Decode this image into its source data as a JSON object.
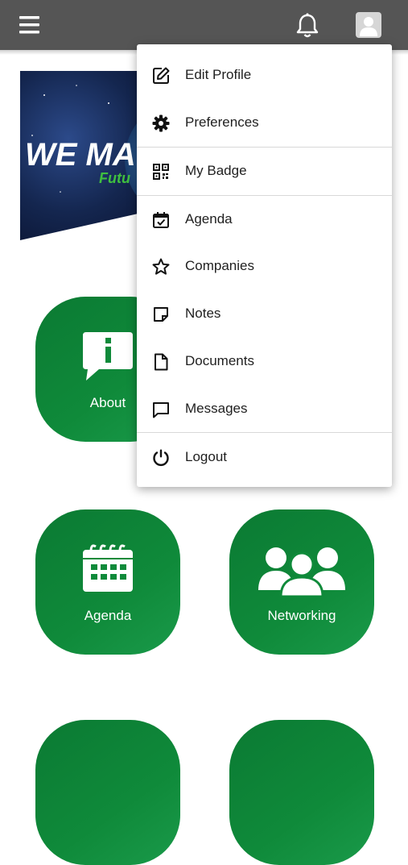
{
  "header": {
    "menu_icon": "hamburger-icon",
    "notification_icon": "bell-icon",
    "profile_icon": "avatar-icon"
  },
  "banner": {
    "text_main": "WE MA",
    "text_sub": "Futu"
  },
  "tiles": [
    {
      "label": "About",
      "icon": "info-chat-icon"
    },
    {
      "label": "Agenda",
      "icon": "calendar-icon"
    },
    {
      "label": "Networking",
      "icon": "people-group-icon"
    }
  ],
  "dropdown": {
    "items": [
      {
        "label": "Edit Profile",
        "icon": "edit-icon"
      },
      {
        "label": "Preferences",
        "icon": "gear-icon"
      },
      {
        "label": "My Badge",
        "icon": "qr-code-icon"
      },
      {
        "label": "Agenda",
        "icon": "calendar-check-icon"
      },
      {
        "label": "Companies",
        "icon": "star-icon"
      },
      {
        "label": "Notes",
        "icon": "note-icon"
      },
      {
        "label": "Documents",
        "icon": "document-icon"
      },
      {
        "label": "Messages",
        "icon": "message-icon"
      },
      {
        "label": "Logout",
        "icon": "power-icon"
      }
    ]
  },
  "colors": {
    "topbar": "#555555",
    "tile_green": "#0f8a3a",
    "banner_accent": "#3fbf3f"
  }
}
